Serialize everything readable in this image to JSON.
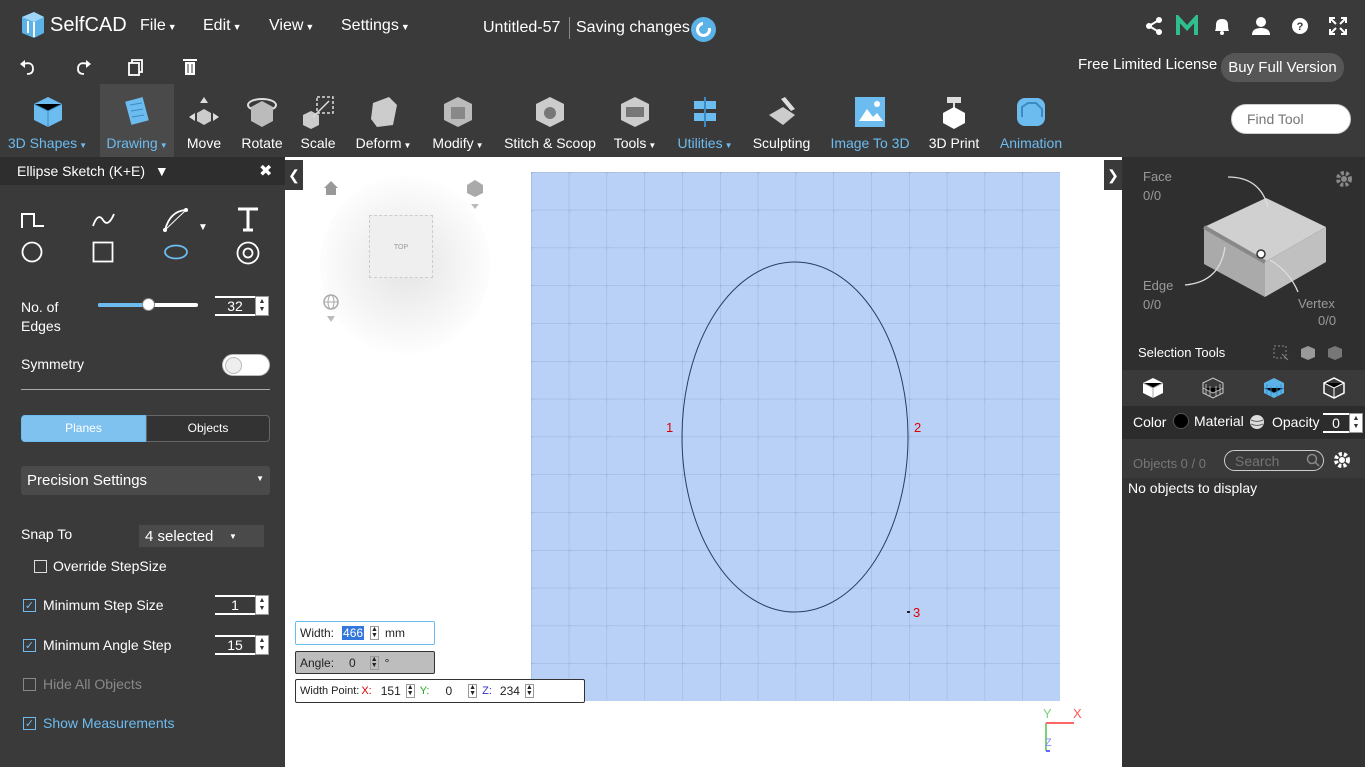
{
  "app": {
    "logo_text": "SelfCAD",
    "doc_name": "Untitled-57",
    "saving_status": "Saving changes"
  },
  "menu": [
    {
      "label": "File"
    },
    {
      "label": "Edit"
    },
    {
      "label": "View"
    },
    {
      "label": "Settings"
    }
  ],
  "topicons": [
    "share-icon",
    "m-icon",
    "bell-icon",
    "user-icon",
    "help-icon",
    "fullscreen-icon"
  ],
  "secbar": {
    "license": "Free Limited License",
    "buy_label": "Buy Full Version"
  },
  "toolbar": {
    "tools": [
      {
        "label": "3D Shapes",
        "caret": true,
        "blue": true
      },
      {
        "label": "Drawing",
        "caret": true,
        "blue": true,
        "active": true
      },
      {
        "label": "Move"
      },
      {
        "label": "Rotate"
      },
      {
        "label": "Scale"
      },
      {
        "label": "Deform",
        "caret": true
      },
      {
        "label": "Modify",
        "caret": true
      },
      {
        "label": "Stitch & Scoop"
      },
      {
        "label": "Tools",
        "caret": true
      },
      {
        "label": "Utilities",
        "caret": true,
        "blue": true
      },
      {
        "label": "Sculpting"
      },
      {
        "label": "Image To 3D",
        "blue": true
      },
      {
        "label": "3D Print"
      },
      {
        "label": "Animation",
        "blue": true
      }
    ],
    "find_placeholder": "Find Tool"
  },
  "leftpanel": {
    "title": "Ellipse Sketch (K+E)",
    "edges_label": "No. of Edges",
    "edges_label_l1": "No. of",
    "edges_label_l2": "Edges",
    "edges_value": "32",
    "edges_slider_fraction": 0.5,
    "symmetry_label": "Symmetry",
    "symmetry_on": false,
    "tab_planes": "Planes",
    "tab_objects": "Objects",
    "precision_label": "Precision Settings",
    "snap_label": "Snap To",
    "snap_value": "4 selected",
    "override_label": "Override StepSize",
    "min_step_label": "Minimum Step Size",
    "min_step_value": "1",
    "min_angle_label": "Minimum Angle Step",
    "min_angle_value": "15",
    "hide_all_label": "Hide All Objects",
    "show_meas_label": "Show Measurements"
  },
  "viewport": {
    "nav_cube_label": "TOP",
    "points": [
      "1",
      "2",
      "3"
    ],
    "width_label": "Width:",
    "width_value": "466",
    "width_unit": "mm",
    "angle_label": "Angle:",
    "angle_value": "0",
    "angle_unit": "°",
    "wp_label": "Width Point:",
    "wp_x_label": "X:",
    "wp_x": "151",
    "wp_y_label": "Y:",
    "wp_y": "0",
    "wp_z_label": "Z:",
    "wp_z": "234",
    "axis_y": "Y",
    "axis_x": "X",
    "axis_z": "Z"
  },
  "rightpanel": {
    "face_label": "Face",
    "face_count": "0/0",
    "edge_label": "Edge",
    "edge_count": "0/0",
    "vertex_label": "Vertex",
    "vertex_count": "0/0",
    "selection_tools": "Selection Tools",
    "color_label": "Color",
    "material_label": "Material",
    "opacity_label": "Opacity",
    "opacity_value": "0",
    "objects_label": "Objects 0 / 0",
    "search_placeholder": "Search",
    "empty_text": "No objects to display"
  },
  "colors": {
    "accent": "#6dbcf0",
    "dark": "#3a3a3a",
    "plane": "#b9d1f7"
  }
}
